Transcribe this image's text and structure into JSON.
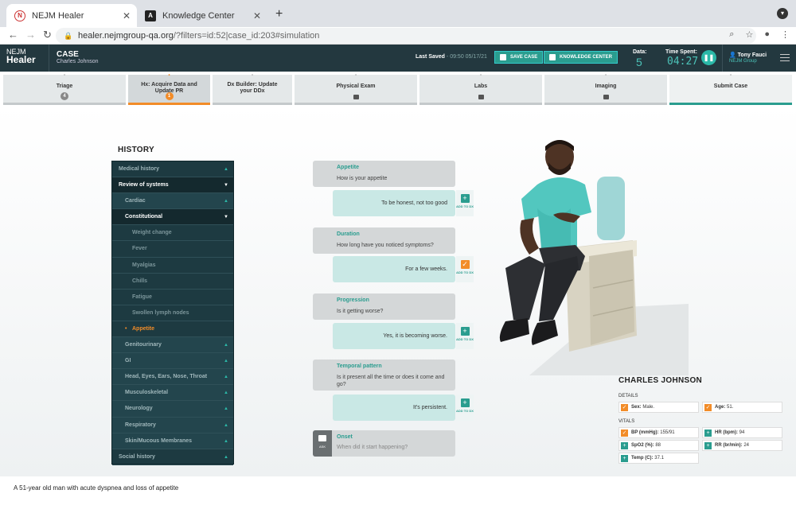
{
  "browser": {
    "tabs": [
      {
        "title": "NEJM Healer",
        "icon": "nejm-favicon"
      },
      {
        "title": "Knowledge Center",
        "icon": "angular-favicon"
      }
    ],
    "url_host": "healer.nejmgroup-qa.org",
    "url_path": "/?filters=id:52|case_id:203#simulation"
  },
  "header": {
    "logo_top": "NEJM",
    "logo_bottom": "Healer",
    "case_label": "CASE",
    "patient": "Charles Johnson",
    "last_saved_label": "Last Saved",
    "last_saved_value": "- 09:50 05/17/21",
    "save_case": "SAVE CASE",
    "knowledge_center": "KNOWLEDGE CENTER",
    "data_label": "Data:",
    "data_value": "5",
    "time_label": "Time Spent:",
    "time_value": "04:27",
    "user_name": "Tony Fauci",
    "user_org": "NEJM Group"
  },
  "steps": [
    {
      "label": "Triage",
      "badge": "4",
      "state": "normal"
    },
    {
      "label": "Hx: Acquire Data and Update PR",
      "badge": "1",
      "state": "active"
    },
    {
      "label": "Dx Builder: Update your DDx",
      "badge": "",
      "state": "normal"
    },
    {
      "label": "Physical Exam",
      "badge": "",
      "state": "locked"
    },
    {
      "label": "Labs",
      "badge": "",
      "state": "locked"
    },
    {
      "label": "Imaging",
      "badge": "",
      "state": "locked"
    },
    {
      "label": "Submit Case",
      "badge": "",
      "state": "done"
    }
  ],
  "history": {
    "title": "HISTORY",
    "items": [
      {
        "label": "Medical history",
        "level": 0,
        "chevron": "▲",
        "style": ""
      },
      {
        "label": "Review of systems",
        "level": 0,
        "chevron": "▼",
        "style": "sel"
      },
      {
        "label": "Cardiac",
        "level": 1,
        "chevron": "▲",
        "style": "sub"
      },
      {
        "label": "Constitutional",
        "level": 1,
        "chevron": "▼",
        "style": "sel"
      },
      {
        "label": "Weight change",
        "level": 2,
        "chevron": "",
        "style": "leaf"
      },
      {
        "label": "Fever",
        "level": 2,
        "chevron": "",
        "style": "leaf"
      },
      {
        "label": "Myalgias",
        "level": 2,
        "chevron": "",
        "style": "leaf"
      },
      {
        "label": "Chills",
        "level": 2,
        "chevron": "",
        "style": "leaf"
      },
      {
        "label": "Fatigue",
        "level": 2,
        "chevron": "",
        "style": "leaf"
      },
      {
        "label": "Swollen lymph nodes",
        "level": 2,
        "chevron": "",
        "style": "leaf"
      },
      {
        "label": "Appetite",
        "level": 2,
        "chevron": "",
        "style": "cur"
      },
      {
        "label": "Genitourinary",
        "level": 1,
        "chevron": "▲",
        "style": "sub"
      },
      {
        "label": "GI",
        "level": 1,
        "chevron": "▲",
        "style": "sub"
      },
      {
        "label": "Head, Eyes, Ears, Nose, Throat",
        "level": 1,
        "chevron": "▲",
        "style": "sub"
      },
      {
        "label": "Musculoskeletal",
        "level": 1,
        "chevron": "▲",
        "style": "sub"
      },
      {
        "label": "Neurology",
        "level": 1,
        "chevron": "▲",
        "style": "sub"
      },
      {
        "label": "Respiratory",
        "level": 1,
        "chevron": "▲",
        "style": "sub"
      },
      {
        "label": "Skin/Mucous Membranes",
        "level": 1,
        "chevron": "▲",
        "style": "sub"
      },
      {
        "label": "Social history",
        "level": 0,
        "chevron": "▲",
        "style": ""
      }
    ]
  },
  "chat": [
    {
      "topic": "Appetite",
      "question": "How is your appetite",
      "answer": "To be honest, not too good",
      "added": false
    },
    {
      "topic": "Duration",
      "question": "How long have you noticed symptoms?",
      "answer": "For a few weeks.",
      "added": true
    },
    {
      "topic": "Progression",
      "question": "Is it getting worse?",
      "answer": "Yes, it is becoming worse.",
      "added": false
    },
    {
      "topic": "Temporal pattern",
      "question": "Is it present all the time or does it come and go?",
      "answer": "It's persistent.",
      "added": false
    }
  ],
  "add_to_dx_label": "ADD TO DX",
  "pending": {
    "topic": "Onset",
    "question": "When did it start happening?",
    "ask_label": "ASK"
  },
  "patient_card": {
    "name": "CHARLES JOHNSON",
    "details_label": "DETAILS",
    "vitals_label": "VITALS",
    "details": [
      {
        "label": "Sex:",
        "value": "Male.",
        "checked": true
      },
      {
        "label": "Age:",
        "value": "51.",
        "checked": true
      }
    ],
    "vitals": [
      {
        "label": "BP (mmHg):",
        "value": "155/91",
        "checked": true
      },
      {
        "label": "HR (bpm):",
        "value": "94",
        "checked": false
      },
      {
        "label": "SpO2 (%):",
        "value": "88",
        "checked": false
      },
      {
        "label": "RR (br/min):",
        "value": "24",
        "checked": false
      },
      {
        "label": "Temp (C):",
        "value": "37.1",
        "checked": false
      }
    ]
  },
  "summary": "A 51-year old man with acute dyspnea and loss of appetite"
}
